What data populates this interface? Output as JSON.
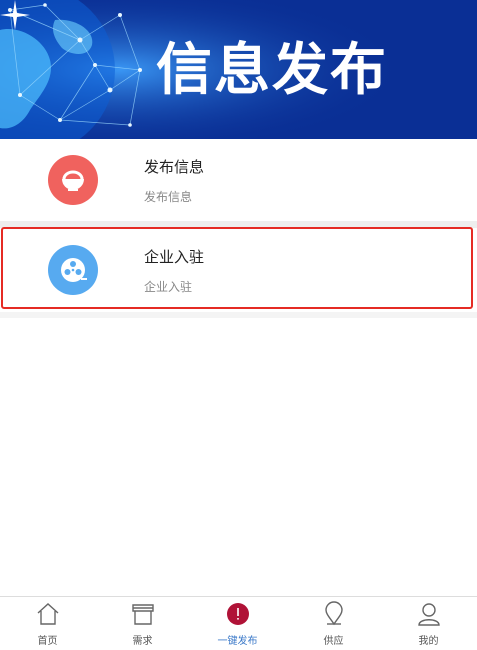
{
  "banner": {
    "title": "信息发布"
  },
  "items": [
    {
      "title": "发布信息",
      "subtitle": "发布信息",
      "icon": "bowl-icon",
      "color": "#f0625e"
    },
    {
      "title": "企业入驻",
      "subtitle": "企业入驻",
      "icon": "film-reel-icon",
      "color": "#57aaf0"
    }
  ],
  "tabbar": {
    "active_color": "#3a78c8",
    "tabs": [
      {
        "label": "首页",
        "icon": "home-icon"
      },
      {
        "label": "需求",
        "icon": "store-icon"
      },
      {
        "label": "一键发布",
        "icon": "publish-icon",
        "active": true
      },
      {
        "label": "供应",
        "icon": "location-pin-icon"
      },
      {
        "label": "我的",
        "icon": "user-icon"
      }
    ]
  },
  "highlight_color": "#e52b24"
}
